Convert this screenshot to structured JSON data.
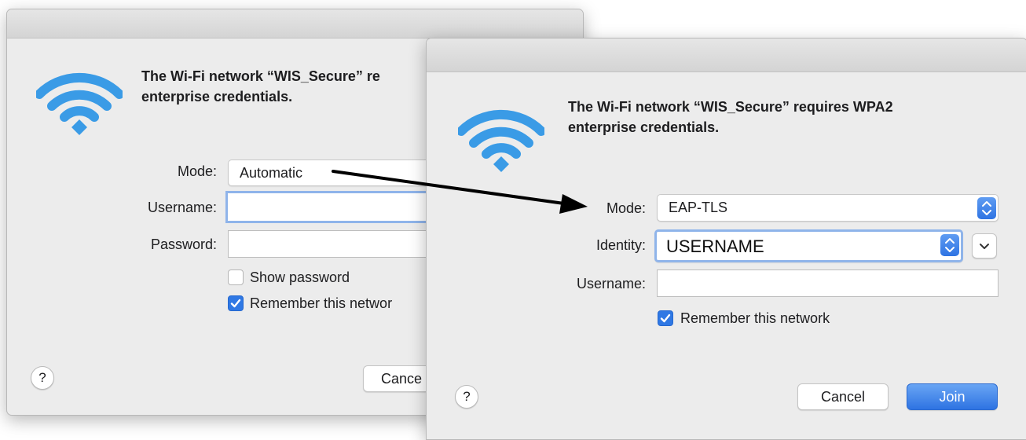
{
  "back_dialog": {
    "heading_line1": "The Wi-Fi network “WIS_Secure” re",
    "heading_line2": "enterprise credentials.",
    "mode_label": "Mode:",
    "mode_value": "Automatic",
    "username_label": "Username:",
    "username_value": "",
    "password_label": "Password:",
    "password_value": "",
    "show_password_label": "Show password",
    "show_password_checked": false,
    "remember_label": "Remember this networ",
    "remember_checked": true,
    "help_label": "?",
    "cancel_label": "Cance"
  },
  "front_dialog": {
    "heading_line1": "The Wi-Fi network “WIS_Secure” requires WPA2",
    "heading_line2": "enterprise credentials.",
    "mode_label": "Mode:",
    "mode_value": "EAP-TLS",
    "identity_label": "Identity:",
    "identity_value": "USERNAME",
    "username_label": "Username:",
    "username_value": "",
    "remember_label": "Remember this network",
    "remember_checked": true,
    "help_label": "?",
    "cancel_label": "Cancel",
    "join_label": "Join"
  },
  "icons": {
    "wifi": "wifi-icon",
    "arrow": "annotation-arrow-icon",
    "check": "checkmark-icon",
    "stepper": "up-down-chevron-icon",
    "dropdown": "chevron-down-icon"
  },
  "colors": {
    "accent": "#2f78e4",
    "wifi": "#3a9be6"
  }
}
